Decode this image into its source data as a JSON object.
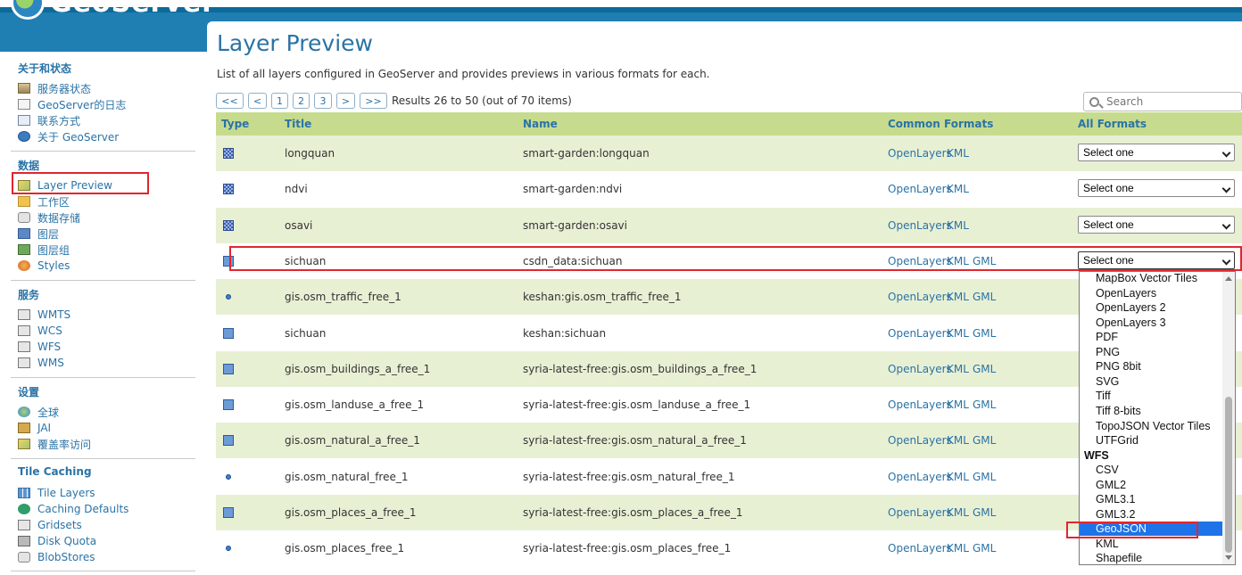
{
  "app": {
    "logo_text": "GeoServer"
  },
  "sidebar": {
    "sections": [
      {
        "title": "关于和状态",
        "items": [
          {
            "label": "服务器状态",
            "icon": "server-icon"
          },
          {
            "label": "GeoServer的日志",
            "icon": "log-icon"
          },
          {
            "label": "联系方式",
            "icon": "contact-icon"
          },
          {
            "label": "关于 GeoServer",
            "icon": "info-icon"
          }
        ]
      },
      {
        "title": "数据",
        "items": [
          {
            "label": "Layer Preview",
            "icon": "map-preview-icon"
          },
          {
            "label": "工作区",
            "icon": "folder-icon"
          },
          {
            "label": "数据存储",
            "icon": "database-icon"
          },
          {
            "label": "图层",
            "icon": "layer-icon"
          },
          {
            "label": "图层组",
            "icon": "layer-group-icon"
          },
          {
            "label": "Styles",
            "icon": "palette-icon"
          }
        ]
      },
      {
        "title": "服务",
        "items": [
          {
            "label": "WMTS",
            "icon": "service-icon"
          },
          {
            "label": "WCS",
            "icon": "service-icon"
          },
          {
            "label": "WFS",
            "icon": "service-icon"
          },
          {
            "label": "WMS",
            "icon": "service-icon"
          }
        ]
      },
      {
        "title": "设置",
        "items": [
          {
            "label": "全球",
            "icon": "globe-icon"
          },
          {
            "label": "JAI",
            "icon": "jai-icon"
          },
          {
            "label": "覆盖率访问",
            "icon": "coverage-icon"
          }
        ]
      },
      {
        "title": "Tile Caching",
        "items": [
          {
            "label": "Tile Layers",
            "icon": "tiles-icon"
          },
          {
            "label": "Caching Defaults",
            "icon": "caching-icon"
          },
          {
            "label": "Gridsets",
            "icon": "grid-icon"
          },
          {
            "label": "Disk Quota",
            "icon": "disk-icon"
          },
          {
            "label": "BlobStores",
            "icon": "blobstore-icon"
          }
        ]
      }
    ]
  },
  "main": {
    "title": "Layer Preview",
    "description": "List of all layers configured in GeoServer and provides previews in various formats for each.",
    "pager": {
      "first": "<<",
      "prev": "<",
      "pages": [
        "1",
        "2",
        "3"
      ],
      "next": ">",
      "last": ">>",
      "results": "Results 26 to 50 (out of 70 items)"
    },
    "search": {
      "placeholder": "Search"
    },
    "columns": [
      "Type",
      "Title",
      "Name",
      "Common Formats",
      "All Formats"
    ],
    "rows": [
      {
        "type": "raster",
        "title": "longquan",
        "name": "smart-garden:longquan",
        "formats": [
          "OpenLayers",
          "KML"
        ],
        "select": "Select one"
      },
      {
        "type": "raster",
        "title": "ndvi",
        "name": "smart-garden:ndvi",
        "formats": [
          "OpenLayers",
          "KML"
        ],
        "select": "Select one"
      },
      {
        "type": "raster",
        "title": "osavi",
        "name": "smart-garden:osavi",
        "formats": [
          "OpenLayers",
          "KML"
        ],
        "select": "Select one"
      },
      {
        "type": "polygon",
        "title": "sichuan",
        "name": "csdn_data:sichuan",
        "formats": [
          "OpenLayers",
          "KML",
          "GML"
        ],
        "select": "Select one"
      },
      {
        "type": "point",
        "title": "gis.osm_traffic_free_1",
        "name": "keshan:gis.osm_traffic_free_1",
        "formats": [
          "OpenLayers",
          "KML",
          "GML"
        ]
      },
      {
        "type": "polygon",
        "title": "sichuan",
        "name": "keshan:sichuan",
        "formats": [
          "OpenLayers",
          "KML",
          "GML"
        ]
      },
      {
        "type": "polygon",
        "title": "gis.osm_buildings_a_free_1",
        "name": "syria-latest-free:gis.osm_buildings_a_free_1",
        "formats": [
          "OpenLayers",
          "KML",
          "GML"
        ]
      },
      {
        "type": "polygon",
        "title": "gis.osm_landuse_a_free_1",
        "name": "syria-latest-free:gis.osm_landuse_a_free_1",
        "formats": [
          "OpenLayers",
          "KML",
          "GML"
        ]
      },
      {
        "type": "polygon",
        "title": "gis.osm_natural_a_free_1",
        "name": "syria-latest-free:gis.osm_natural_a_free_1",
        "formats": [
          "OpenLayers",
          "KML",
          "GML"
        ]
      },
      {
        "type": "point",
        "title": "gis.osm_natural_free_1",
        "name": "syria-latest-free:gis.osm_natural_free_1",
        "formats": [
          "OpenLayers",
          "KML",
          "GML"
        ]
      },
      {
        "type": "polygon",
        "title": "gis.osm_places_a_free_1",
        "name": "syria-latest-free:gis.osm_places_a_free_1",
        "formats": [
          "OpenLayers",
          "KML",
          "GML"
        ]
      },
      {
        "type": "point",
        "title": "gis.osm_places_free_1",
        "name": "syria-latest-free:gis.osm_places_free_1",
        "formats": [
          "OpenLayers",
          "KML",
          "GML"
        ]
      }
    ],
    "dropdown": {
      "entries": [
        {
          "kind": "option",
          "label": "MapBox Vector Tiles"
        },
        {
          "kind": "option",
          "label": "OpenLayers"
        },
        {
          "kind": "option",
          "label": "OpenLayers 2"
        },
        {
          "kind": "option",
          "label": "OpenLayers 3"
        },
        {
          "kind": "option",
          "label": "PDF"
        },
        {
          "kind": "option",
          "label": "PNG"
        },
        {
          "kind": "option",
          "label": "PNG 8bit"
        },
        {
          "kind": "option",
          "label": "SVG"
        },
        {
          "kind": "option",
          "label": "Tiff"
        },
        {
          "kind": "option",
          "label": "Tiff 8-bits"
        },
        {
          "kind": "option",
          "label": "TopoJSON Vector Tiles"
        },
        {
          "kind": "option",
          "label": "UTFGrid"
        },
        {
          "kind": "group",
          "label": "WFS"
        },
        {
          "kind": "option",
          "label": "CSV"
        },
        {
          "kind": "option",
          "label": "GML2"
        },
        {
          "kind": "option",
          "label": "GML3.1"
        },
        {
          "kind": "option",
          "label": "GML3.2"
        },
        {
          "kind": "option",
          "label": "GeoJSON",
          "highlighted": true
        },
        {
          "kind": "option",
          "label": "KML"
        },
        {
          "kind": "option",
          "label": "Shapefile"
        }
      ]
    }
  },
  "colors": {
    "accent": "#2a73a6",
    "header": "#1f7fb3",
    "row_alt": "#e8f0d4",
    "table_header": "#c7db8e",
    "highlight": "#1e73e8",
    "annotation": "#e0262f"
  }
}
